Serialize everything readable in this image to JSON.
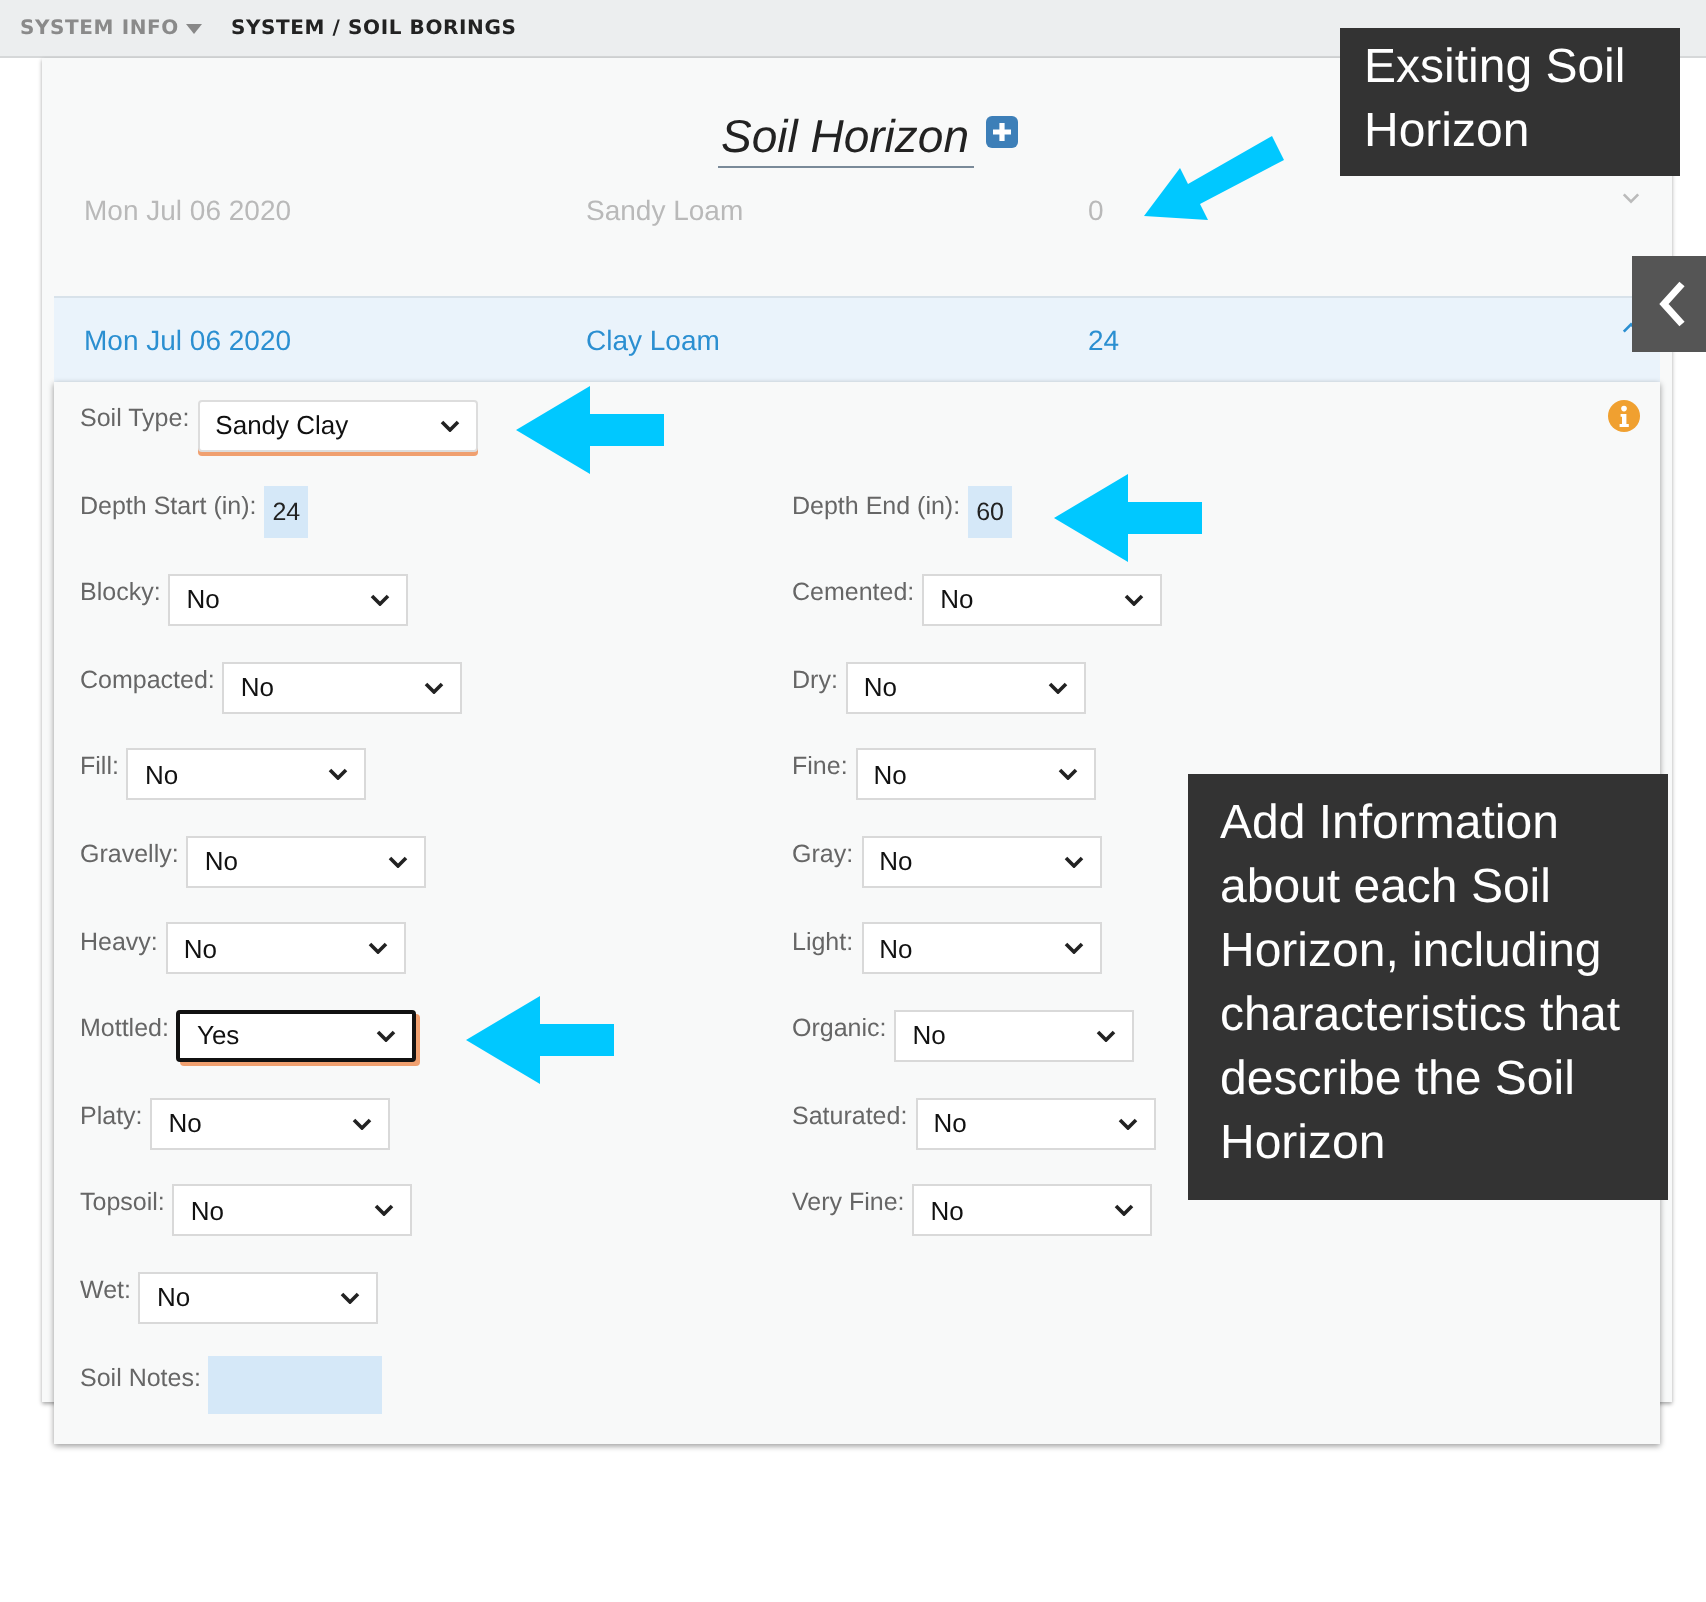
{
  "breadcrumb": {
    "menu": "SYSTEM INFO",
    "path": "SYSTEM / SOIL BORINGS"
  },
  "title": "Soil Horizon",
  "horizons": [
    {
      "date": "Mon Jul 06 2020",
      "texture": "Sandy Loam",
      "depth": "0",
      "expanded": false
    },
    {
      "date": "Mon Jul 06 2020",
      "texture": "Clay Loam",
      "depth": "24",
      "expanded": true
    }
  ],
  "form": {
    "soil_type": {
      "label": "Soil Type:",
      "value": "Sandy Clay",
      "highlighted": true
    },
    "depth_start": {
      "label": "Depth Start (in):",
      "value": "24"
    },
    "depth_end": {
      "label": "Depth End (in):",
      "value": "60"
    },
    "left": [
      {
        "label": "Blocky:",
        "value": "No",
        "highlighted": false
      },
      {
        "label": "Compacted:",
        "value": "No",
        "highlighted": false
      },
      {
        "label": "Fill:",
        "value": "No",
        "highlighted": false
      },
      {
        "label": "Gravelly:",
        "value": "No",
        "highlighted": false
      },
      {
        "label": "Heavy:",
        "value": "No",
        "highlighted": false
      },
      {
        "label": "Mottled:",
        "value": "Yes",
        "highlighted": true
      },
      {
        "label": "Platy:",
        "value": "No",
        "highlighted": false
      },
      {
        "label": "Topsoil:",
        "value": "No",
        "highlighted": false
      },
      {
        "label": "Wet:",
        "value": "No",
        "highlighted": false
      }
    ],
    "right": [
      {
        "label": "Cemented:",
        "value": "No",
        "highlighted": false
      },
      {
        "label": "Dry:",
        "value": "No",
        "highlighted": false
      },
      {
        "label": "Fine:",
        "value": "No",
        "highlighted": false
      },
      {
        "label": "Gray:",
        "value": "No",
        "highlighted": false
      },
      {
        "label": "Light:",
        "value": "No",
        "highlighted": false
      },
      {
        "label": "Organic:",
        "value": "No",
        "highlighted": false
      },
      {
        "label": "Saturated:",
        "value": "No",
        "highlighted": false
      },
      {
        "label": "Very Fine:",
        "value": "No",
        "highlighted": false
      }
    ],
    "notes": {
      "label": "Soil Notes:"
    }
  },
  "callouts": [
    "Exsiting Soil Horizon",
    "Add Information about each Soil Horizon, including characteristics that describe the Soil Horizon"
  ]
}
